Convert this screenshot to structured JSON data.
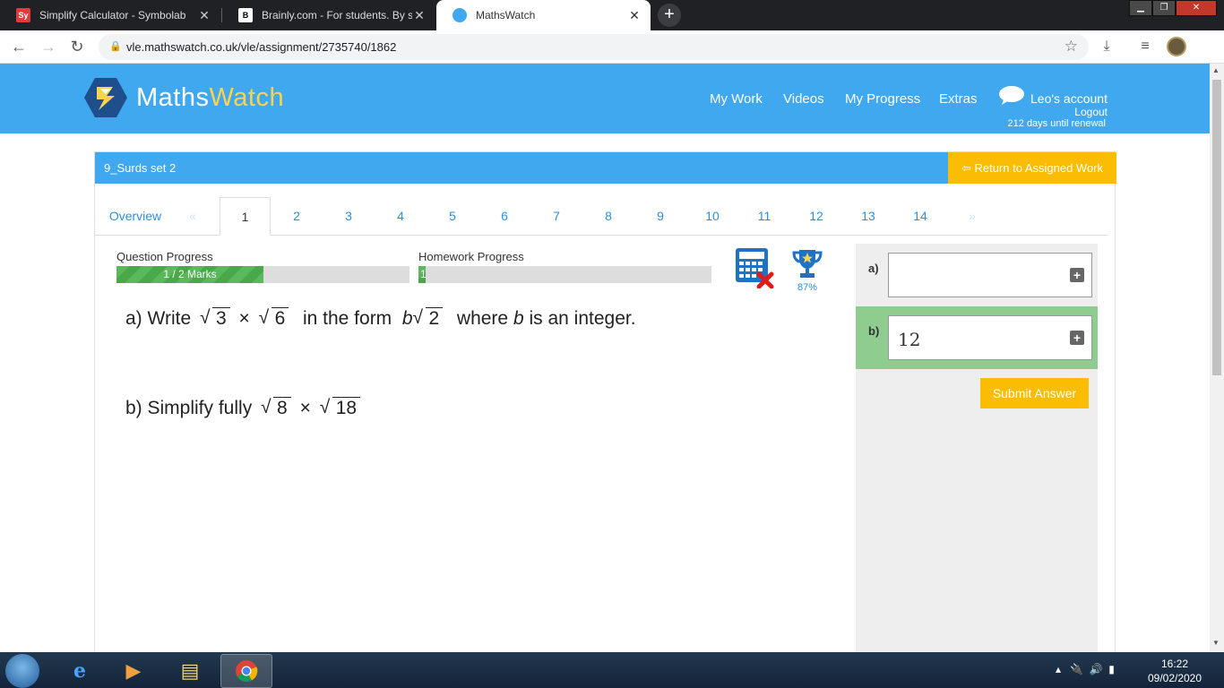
{
  "browser": {
    "tabs": [
      {
        "title": "Simplify Calculator - Symbolab",
        "favicon": "Sy",
        "active": false
      },
      {
        "title": "Brainly.com - For students. By stu",
        "favicon": "B",
        "active": false
      },
      {
        "title": "MathsWatch",
        "favicon": "mw",
        "active": true
      }
    ],
    "url": "vle.mathswatch.co.uk/vle/assignment/2735740/1862"
  },
  "site": {
    "logo_part1": "Maths",
    "logo_part2": "Watch",
    "nav": [
      "My Work",
      "Videos",
      "My Progress",
      "Extras"
    ],
    "account": "Leo's account",
    "logout": "Logout",
    "renewal": "212 days until renewal"
  },
  "assignment": {
    "title": "9_Surds set 2",
    "return_label": "Return to Assigned Work",
    "tabs": [
      "Overview",
      "«",
      "1",
      "2",
      "3",
      "4",
      "5",
      "6",
      "7",
      "8",
      "9",
      "10",
      "11",
      "12",
      "13",
      "14",
      "»"
    ],
    "active_tab": "1"
  },
  "progress": {
    "question_label": "Question Progress",
    "question_text": "1 / 2 Marks",
    "question_fraction": 0.5,
    "homework_label": "Homework Progress",
    "homework_text": "1",
    "homework_fraction": 0.02,
    "trophy_pct": "87%"
  },
  "question": {
    "a_prefix": "a) Write",
    "a_r1": "3",
    "a_times": "×",
    "a_r2": "6",
    "a_mid": "in the form",
    "a_b": "b",
    "a_r3": "2",
    "a_where": "where",
    "a_b2": "b",
    "a_suffix": "is an integer.",
    "b_prefix": "b) Simplify fully",
    "b_r1": "8",
    "b_times": "×",
    "b_r2": "18"
  },
  "answers": {
    "a_label": "a)",
    "a_value": "",
    "b_label": "b)",
    "b_value": "12",
    "submit": "Submit Answer"
  },
  "taskbar": {
    "time": "16:22",
    "date": "09/02/2020"
  },
  "colors": {
    "brand_blue": "#3fa8ef",
    "accent_yellow": "#fbbc04",
    "progress_green": "#5cb85c",
    "answer_highlight": "#8fcc8f"
  }
}
